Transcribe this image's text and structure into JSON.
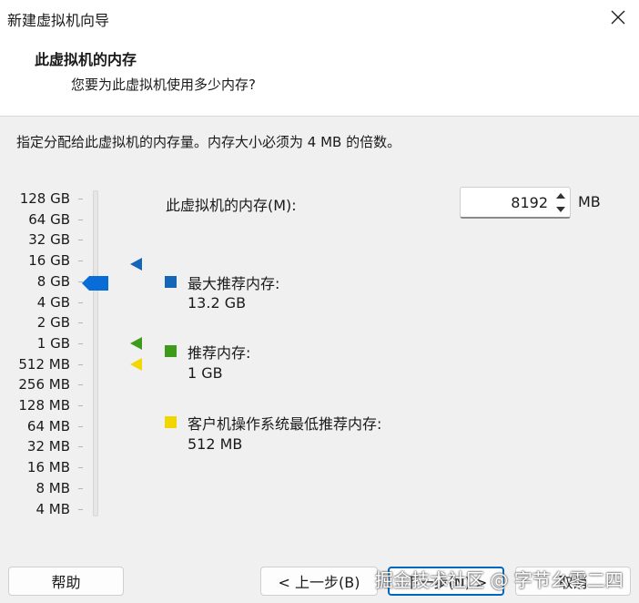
{
  "window": {
    "title": "新建虚拟机向导"
  },
  "header": {
    "title": "此虚拟机的内存",
    "subtitle": "您要为此虚拟机使用多少内存?"
  },
  "instruction": "指定分配给此虚拟机的内存量。内存大小必须为 4 MB 的倍数。",
  "scale_labels": [
    "128 GB",
    "64 GB",
    "32 GB",
    "16 GB",
    "8 GB",
    "4 GB",
    "2 GB",
    "1 GB",
    "512 MB",
    "256 MB",
    "128 MB",
    "64 MB",
    "32 MB",
    "16 MB",
    "8 MB",
    "4 MB"
  ],
  "memory": {
    "label": "此虚拟机的内存(M):",
    "value": "8192",
    "unit": "MB",
    "selected_scale": "8 GB"
  },
  "legend": {
    "max": {
      "label": "最大推荐内存:",
      "value": "13.2 GB",
      "color": "#1666b8"
    },
    "recommended": {
      "label": "推荐内存:",
      "value": "1 GB",
      "color": "#3e9a1a"
    },
    "minimum": {
      "label": "客户机操作系统最低推荐内存:",
      "value": "512 MB",
      "color": "#f2d600"
    }
  },
  "buttons": {
    "help": "帮助",
    "back": "< 上一步(B)",
    "next": "下一步(N) >",
    "cancel": "取消"
  },
  "watermark": "掘金技术社区 @ 字节幺零二四",
  "colors": {
    "thumb": "#0a6cd6"
  }
}
